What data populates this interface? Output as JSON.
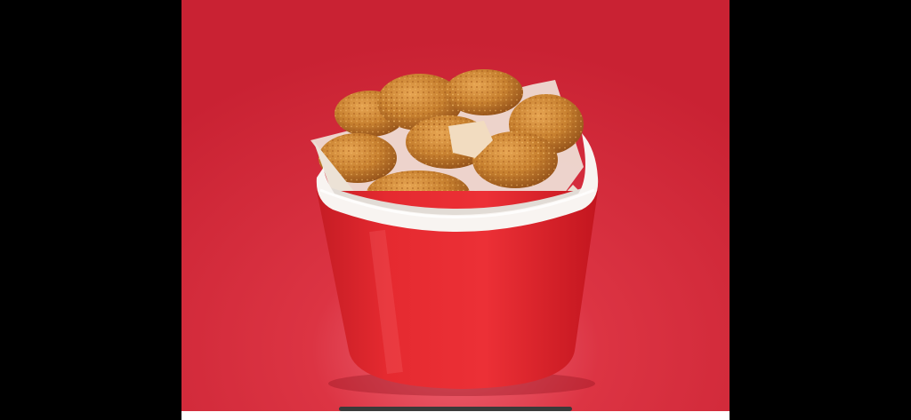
{
  "photo": {
    "subject_icon": "fried-chicken-bucket-icon",
    "colors": {
      "background": "#cf2637",
      "bucket": "#e42a32",
      "bucket_rim": "#f7f3f1",
      "chicken": "#c9822f",
      "paper": "#efe6dc",
      "letterbox": "#000000"
    }
  }
}
